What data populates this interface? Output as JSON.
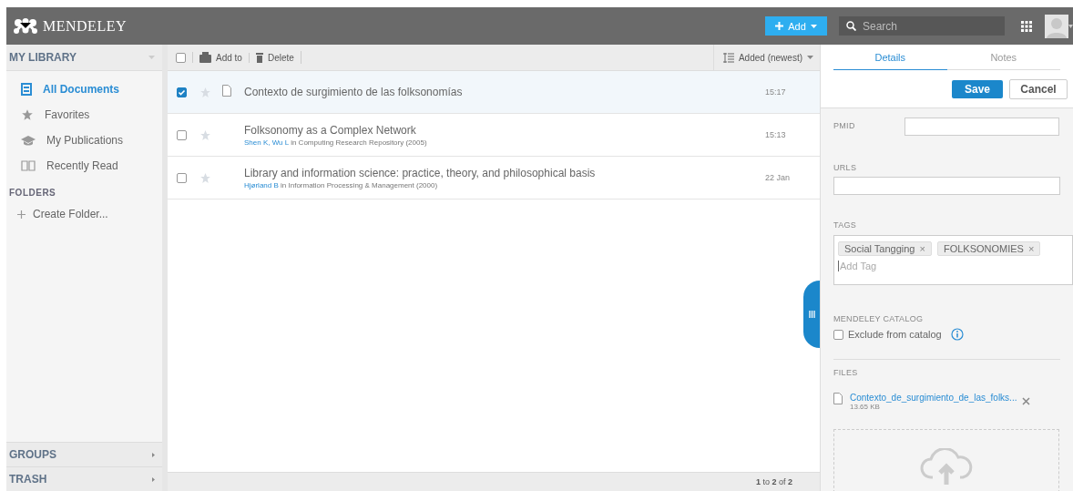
{
  "header": {
    "logo": "MENDELEY",
    "add_button": "Add",
    "search": {
      "placeholder": "Search"
    }
  },
  "sidebar": {
    "library_title": "MY LIBRARY",
    "items": [
      {
        "label": "All Documents",
        "selected": true
      },
      {
        "label": "Favorites",
        "selected": false
      },
      {
        "label": "My Publications",
        "selected": false
      },
      {
        "label": "Recently Read",
        "selected": false
      }
    ],
    "folders_title": "FOLDERS",
    "create_folder": "Create Folder...",
    "groups": "GROUPS",
    "trash": "TRASH"
  },
  "toolbar": {
    "select_all_checked": false,
    "add_to": "Add to",
    "delete": "Delete",
    "sort": "Added (newest)"
  },
  "documents": [
    {
      "title": "Contexto de surgimiento de las folksonomías",
      "date": "15:17",
      "checked": true,
      "has_file": true
    },
    {
      "title": "Folksonomy as a Complex Network",
      "authors": "Shen K, Wu L",
      "source": "in Computing Research Repository (2005)",
      "date": "15:13",
      "checked": false,
      "has_file": false
    },
    {
      "title": "Library and information science: practice, theory, and philosophical basis",
      "authors": "Hjørland B",
      "source": "in Information Processing & Management (2000)",
      "date": "22 Jan",
      "checked": false,
      "has_file": false
    }
  ],
  "footer": "**1** to **2** of **2**",
  "details": {
    "tabs": [
      {
        "label": "Details",
        "selected": true
      },
      {
        "label": "Notes",
        "selected": false
      }
    ],
    "save": "Save",
    "cancel": "Cancel",
    "pmid_label": "PMID",
    "urls_label": "URLS",
    "tags_label": "TAGS",
    "tags": [
      {
        "label": "Social Tangging",
        "remove": "×"
      },
      {
        "label": "FOLKSONOMIES",
        "remove": "×"
      }
    ],
    "tag_placeholder": "Add Tag",
    "catalog_label": "MENDELEY CATALOG",
    "exclude": {
      "label": "Exclude from catalog",
      "checked": false
    },
    "files_label": "FILES",
    "file": {
      "name": "Contexto_de_surgimiento_de_las_folks...",
      "size": "13.65 KB"
    }
  }
}
